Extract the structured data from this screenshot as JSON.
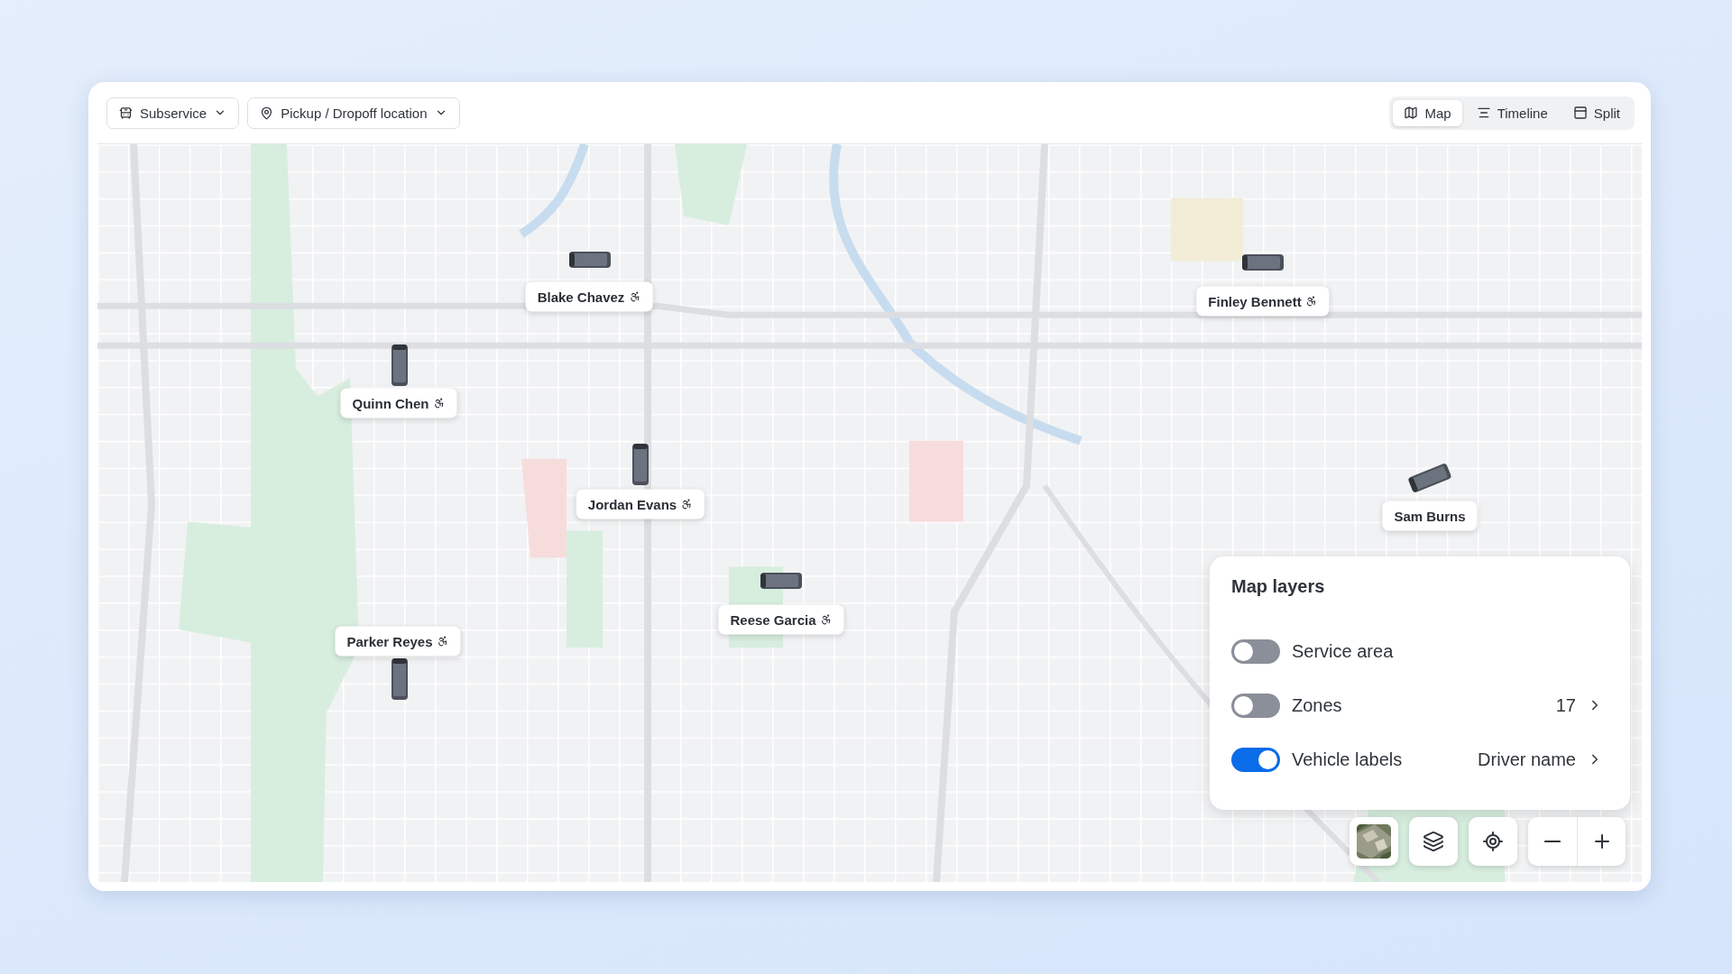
{
  "toolbar": {
    "filters": [
      {
        "label": "Subservice"
      },
      {
        "label": "Pickup / Dropoff location"
      }
    ],
    "view_tabs": [
      {
        "label": "Map",
        "selected": true
      },
      {
        "label": "Timeline",
        "selected": false
      },
      {
        "label": "Split",
        "selected": false
      }
    ]
  },
  "map": {
    "vehicles": [
      {
        "driver": "Blake Chavez",
        "accessible": true
      },
      {
        "driver": "Quinn Chen",
        "accessible": true
      },
      {
        "driver": "Jordan Evans",
        "accessible": true
      },
      {
        "driver": "Reese Garcia",
        "accessible": true
      },
      {
        "driver": "Parker Reyes",
        "accessible": true
      },
      {
        "driver": "Finley Bennett",
        "accessible": true
      },
      {
        "driver": "Sam Burns",
        "accessible": false
      }
    ],
    "layers_panel": {
      "title": "Map layers",
      "layers": [
        {
          "label": "Service area",
          "on": false
        },
        {
          "label": "Zones",
          "on": false,
          "value": "17"
        },
        {
          "label": "Vehicle labels",
          "on": true,
          "value": "Driver name"
        }
      ]
    }
  }
}
